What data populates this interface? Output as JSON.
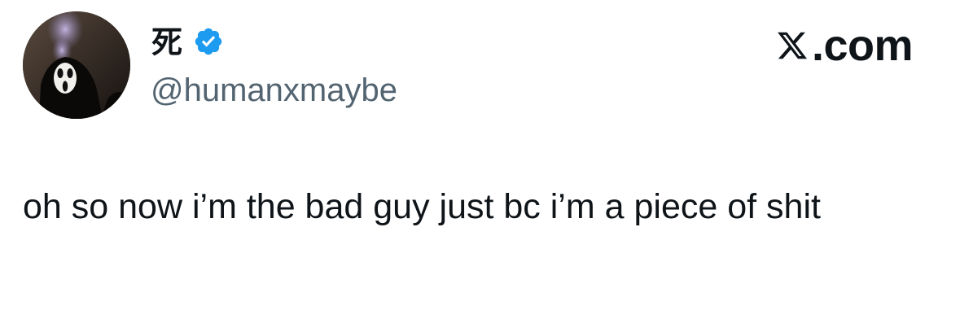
{
  "author": {
    "display_name": "死",
    "verified": true,
    "handle": "@humanxmaybe",
    "avatar_icon": "ghostface-mask-avatar"
  },
  "brand": {
    "icon": "x-logo-icon",
    "text": ".com"
  },
  "tweet": {
    "text": "oh so now i’m the bad guy just bc i’m a piece of shit"
  },
  "colors": {
    "text": "#0f1419",
    "secondary_text": "#536471",
    "verified_badge": "#1d9bf0",
    "background": "#ffffff"
  }
}
